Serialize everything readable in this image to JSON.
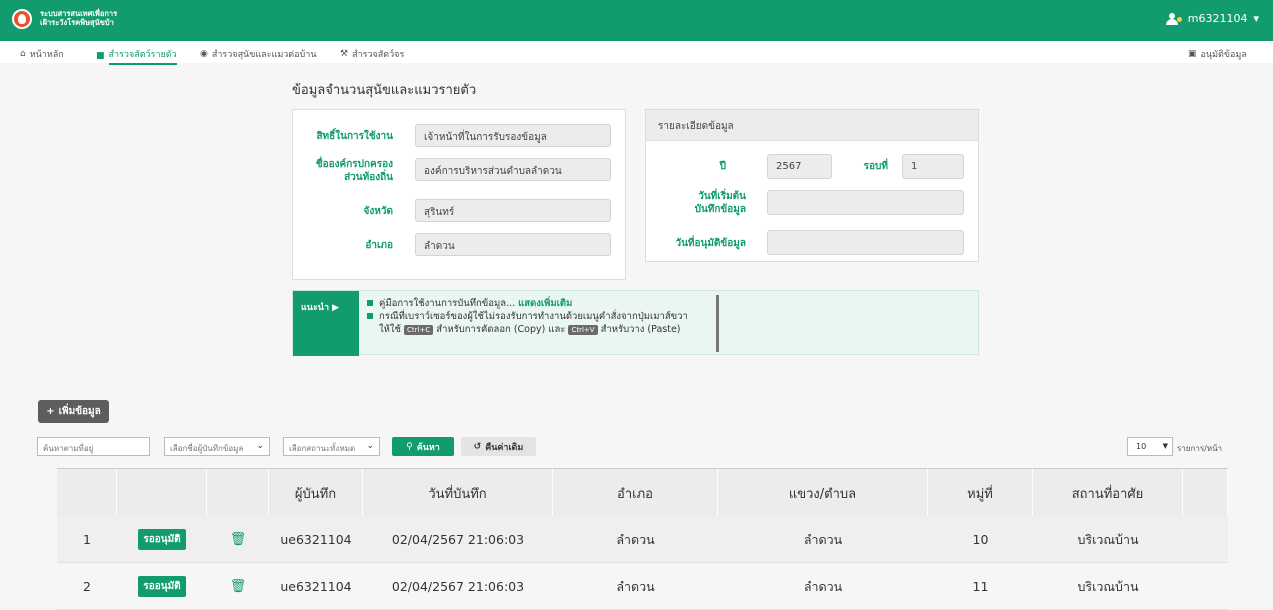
{
  "header": {
    "brand_line1": "ระบบสารสนเทศเพื่อการ",
    "brand_line2": "เฝ้าระวังโรคพิษสุนัขบ้า",
    "username": "m6321104",
    "user_caret": "▾",
    "colors": {
      "primary": "#119b6f",
      "logo": "#e9512b"
    }
  },
  "nav": {
    "items": [
      {
        "label": "หน้าหลัก",
        "icon": "home-icon"
      },
      {
        "label": "สำรวจสัตว์รายตัว",
        "icon": "square-icon",
        "active": true
      },
      {
        "label": "สำรวจสุนัขและแมวต่อบ้าน",
        "icon": "eye-icon"
      },
      {
        "label": "สำรวจสัตว์จร",
        "icon": "tools-icon"
      }
    ],
    "right_label": "อนุมัติข้อมูล",
    "right_icon": "clipboard-icon"
  },
  "page": {
    "title": "ข้อมูลจำนวนสุนัขและแมวรายตัว"
  },
  "info": {
    "role_label": "สิทธิ์ในการใช้งาน",
    "role_value": "เจ้าหน้าที่ในการรับรองข้อมูล",
    "org_label_1": "ชื่อองค์กรปกครอง",
    "org_label_2": "ส่วนท้องถิ่น",
    "org_value": "องค์การบริหารส่วนตำบลลำดวน",
    "province_label": "จังหวัด",
    "province_value": "สุรินทร์",
    "district_label": "อำเภอ",
    "district_value": "ลำดวน"
  },
  "detail": {
    "title": "รายละเอียดข้อมูล",
    "year_label": "ปี",
    "year_value": "2567",
    "round_label": "รอบที่",
    "round_value": "1",
    "start_label_1": "วันที่เริ่มต้น",
    "start_label_2": "บันทึกข้อมูล",
    "start_value": "",
    "approve_label": "วันที่อนุมัติข้อมูล",
    "approve_value": ""
  },
  "tips": {
    "tag": "แนะนำ ▶",
    "line1": "คู่มือการใช้งานการบันทึกข้อมูล...",
    "more": "แสดงเพิ่มเติม",
    "line2": "กรณีที่เบราว์เซอร์ของผู้ใช้ไม่รองรับการทำงานด้วยเมนูคำสั่งจากปุ่มเมาส์ขวา",
    "line3_a": "ให้ใช้",
    "key_copy": "Ctrl+C",
    "line3_b": "สำหรับการคัดลอก (Copy) และ",
    "key_paste": "Ctrl+V",
    "line3_c": "สำหรับวาง (Paste)"
  },
  "actions": {
    "add_label": "เพิ่มข้อมูล"
  },
  "filters": {
    "search_placeholder": "ค้นหาตามที่อยู่",
    "recorder_select": "เลือกชื่อผู้บันทึกข้อมูล",
    "status_select": "เลือกสถานะทั้งหมด",
    "search_button": "ค้นหา",
    "reset_button": "คืนค่าเดิม",
    "per_page_value": "10",
    "per_page_label": "รายการ/หน้า"
  },
  "table": {
    "columns": [
      "",
      "",
      "",
      "ผู้บันทึก",
      "วันที่บันทึก",
      "อำเภอ",
      "แขวง/ตำบล",
      "หมู่ที่",
      "สถานที่อาศัย",
      ""
    ],
    "rows": [
      {
        "no": "1",
        "status": "รออนุมัติ",
        "recorder": "ue6321104",
        "date": "02/04/2567 21:06:03",
        "district": "ลำดวน",
        "subdistrict": "ลำดวน",
        "village": "10",
        "place": "บริเวณบ้าน"
      },
      {
        "no": "2",
        "status": "รออนุมัติ",
        "recorder": "ue6321104",
        "date": "02/04/2567 21:06:03",
        "district": "ลำดวน",
        "subdistrict": "ลำดวน",
        "village": "11",
        "place": "บริเวณบ้าน"
      }
    ]
  }
}
